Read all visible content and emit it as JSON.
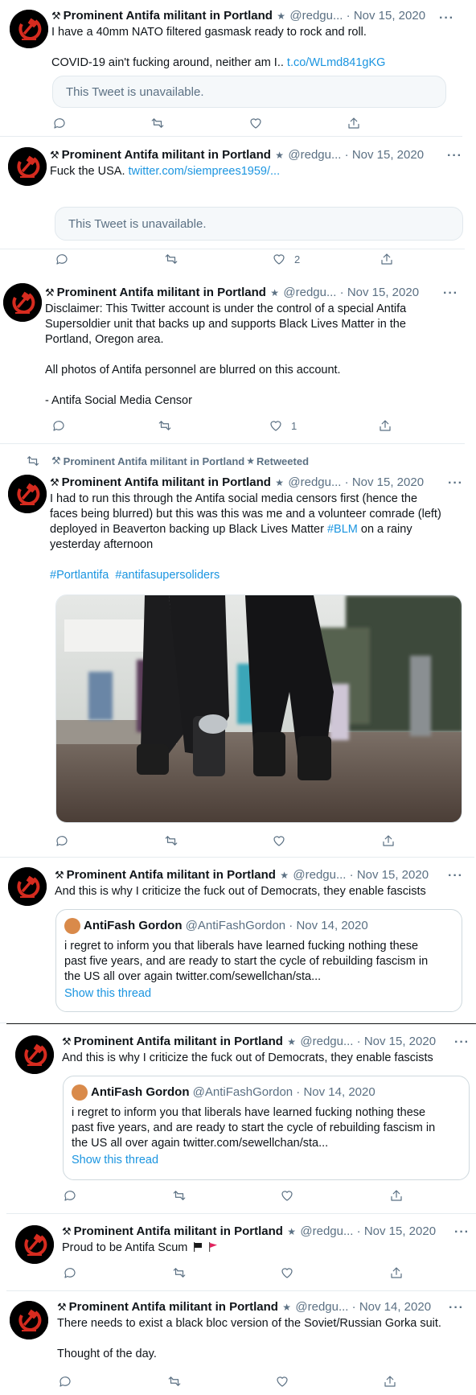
{
  "colors": {
    "link": "#1b95e0",
    "muted": "#5b7083",
    "avatar_red": "#d62b1f"
  },
  "author": {
    "name": "Prominent Antifa militant in Portland",
    "handle": "@redgu...",
    "badge_icon": "star-icon",
    "prefix_icon": "hammer-icon",
    "avatar_caption": "1917 - 2017"
  },
  "tweets": [
    {
      "date": "Nov 15, 2020",
      "lines": [
        "I have a 40mm NATO filtered gasmask ready to rock and roll.",
        "",
        "COVID-19 ain't fucking around, neither am I.. "
      ],
      "link": "t.co/WLmd841gKG",
      "unavailable": "This Tweet is unavailable.",
      "likes": ""
    },
    {
      "date": "Nov 15, 2020",
      "line": "Fuck the USA. ",
      "link": "twitter.com/siemprees1959/...",
      "unavailable": "This Tweet is unavailable.",
      "likes": "2"
    },
    {
      "date": "Nov 15, 2020",
      "lines": [
        "Disclaimer: This Twitter account is under the control of a special Antifa",
        "Supersoldier unit that backs up and supports Black Lives Matter in the",
        "Portland, Oregon area.",
        "",
        "All photos of Antifa personnel are blurred on this account.",
        "",
        "- Antifa Social Media Censor"
      ],
      "likes": "1"
    },
    {
      "retweeted_by": "Prominent Antifa militant in Portland",
      "retweeted_label": "Retweeted",
      "date": "Nov 15, 2020",
      "lines": [
        "I had to run this through the Antifa social media censors first (hence the",
        "faces being blurred) but this was this was me and a volunteer comrade (left)",
        "deployed in Beaverton backing up Black Lives Matter "
      ],
      "hashtag_inline": "#BLM",
      "line_after": " on a rainy",
      "line_last": "yesterday afternoon",
      "hashtags": [
        "#Portlantifa",
        "#antifasupersoliders"
      ],
      "media_alt": "blurred-photo-of-protesters-in-park"
    },
    {
      "date": "Nov 15, 2020",
      "line": "And this is why I criticize the fuck out of Democrats, they enable fascists",
      "quote": {
        "name": "AntiFash Gordon",
        "handle": "@AntiFashGordon",
        "date": "Nov 14, 2020",
        "lines": [
          "i regret to inform you that liberals have learned fucking nothing these",
          "past five years, and are ready to start the cycle of rebuilding fascism in",
          "the US all over again twitter.com/sewellchan/sta..."
        ],
        "show_thread": "Show this thread"
      }
    },
    {
      "date": "Nov 15, 2020",
      "line": "And this is why I criticize the fuck out of Democrats, they enable fascists",
      "quote": {
        "name": "AntiFash Gordon",
        "handle": "@AntiFashGordon",
        "date": "Nov 14, 2020",
        "lines": [
          "i regret to inform you that liberals have learned fucking nothing these",
          "past five years, and are ready to start the cycle of rebuilding fascism in",
          "the US all over again twitter.com/sewellchan/sta..."
        ],
        "show_thread": "Show this thread"
      }
    },
    {
      "date": "Nov 15, 2020",
      "line": "Proud to be Antifa Scum",
      "emojis": [
        "black-flag-icon",
        "red-flag-icon"
      ]
    },
    {
      "date": "Nov 14, 2020",
      "lines": [
        "There needs to exist a black bloc version of the Soviet/Russian Gorka suit.",
        "",
        "Thought of the day."
      ]
    }
  ],
  "ui": {
    "separator": "·",
    "more": "···"
  }
}
